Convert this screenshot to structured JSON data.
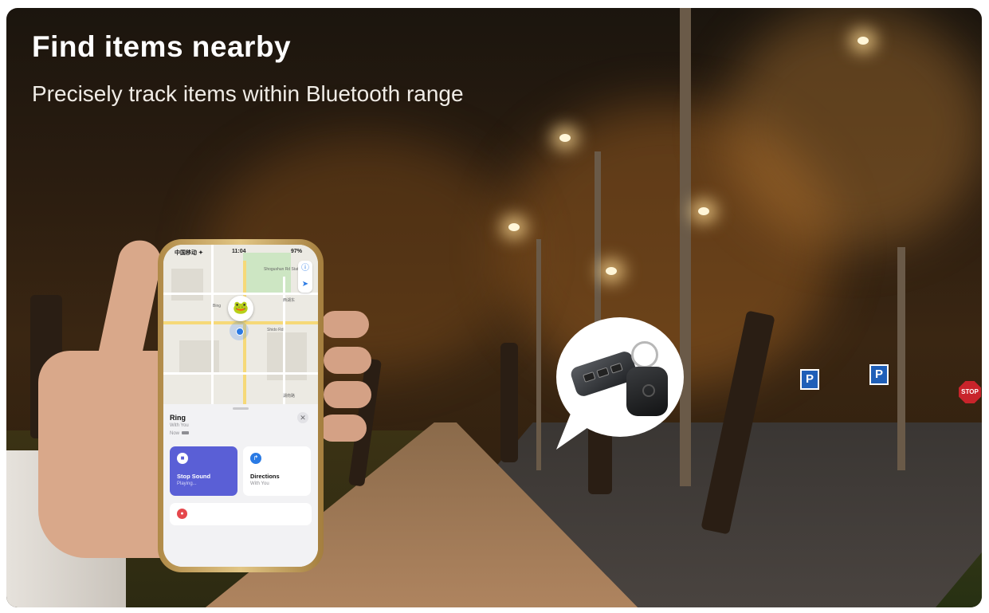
{
  "headline": {
    "title": "Find items nearby",
    "subtitle": "Precisely track items within Bluetooth range"
  },
  "phone": {
    "status": {
      "carrier": "中国移动 ✦",
      "time": "11:04",
      "battery": "97%"
    },
    "map": {
      "labels": [
        "Shogushun Rd Station",
        "西湖东",
        "Bing",
        "Shido Rd",
        "湖南路"
      ],
      "item_icon": "frog-tag-icon",
      "location_icon": "current-location-icon",
      "buttons": [
        "info-icon",
        "locate-arrow-icon"
      ]
    },
    "sheet": {
      "title": "Ring",
      "subtitle": "With You",
      "time": "Now",
      "close_glyph": "✕",
      "actions": [
        {
          "label": "Stop Sound",
          "detail": "Playing...",
          "icon": "stop-icon"
        },
        {
          "label": "Directions",
          "detail": "With You",
          "icon": "directions-arrow-icon"
        }
      ],
      "third_row_icon": "notification-icon"
    }
  },
  "scene": {
    "signs": [
      "P",
      "P"
    ],
    "stop_sign": "STOP"
  },
  "colors": {
    "accent_purple": "#5a5fd6",
    "ios_blue": "#2a7ae4",
    "alert_red": "#e5484d"
  }
}
